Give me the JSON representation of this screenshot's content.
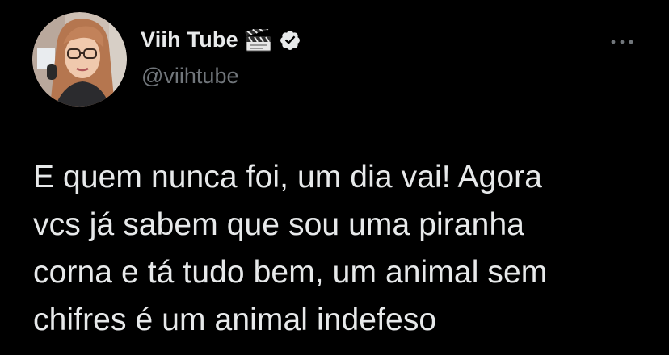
{
  "author": {
    "display_name": "Viih Tube",
    "handle": "@viihtube",
    "emoji_icon": "clapper-board-icon",
    "verified_icon": "verified-badge-icon",
    "avatar": "profile-photo"
  },
  "tweet": {
    "text_lines": [
      "E quem nunca foi, um dia vai! Agora",
      "vcs já sabem que sou uma piranha",
      "corna e tá tudo bem, um animal sem",
      "chifres é um animal indefeso"
    ]
  },
  "menu": {
    "more_icon": "more-options-icon"
  },
  "colors": {
    "background": "#000000",
    "primary_text": "#e7e9ea",
    "secondary_text": "#71767b"
  }
}
